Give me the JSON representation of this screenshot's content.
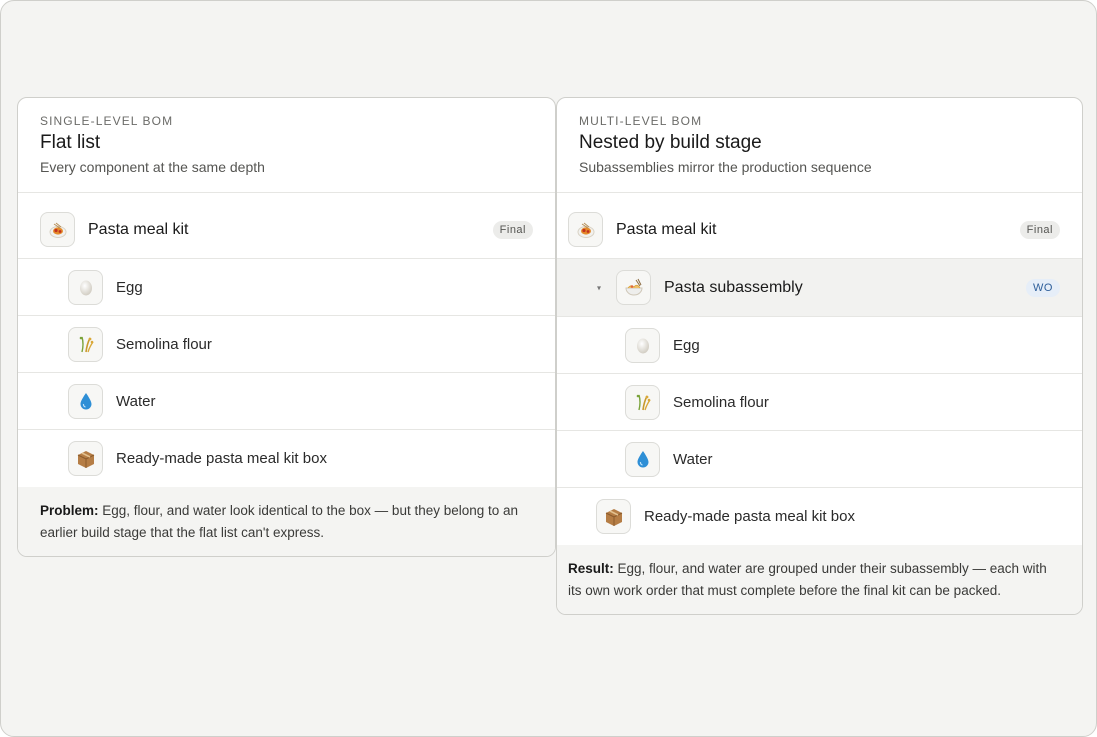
{
  "left": {
    "eyebrow": "SINGLE-LEVEL BOM",
    "title": "Flat list",
    "subtitle": "Every component at the same depth",
    "top_item": {
      "label": "Pasta meal kit",
      "badge": "Final",
      "icon": "pasta-plate-icon"
    },
    "items": [
      {
        "label": "Egg",
        "icon": "egg-icon"
      },
      {
        "label": "Semolina flour",
        "icon": "wheat-icon"
      },
      {
        "label": "Water",
        "icon": "water-drop-icon"
      },
      {
        "label": "Ready-made pasta meal kit box",
        "icon": "box-icon"
      }
    ],
    "note_lead": "Problem:",
    "note_text": " Egg, flour, and water look identical to the box — but they belong to an earlier build stage that the flat list can't express."
  },
  "right": {
    "eyebrow": "MULTI-LEVEL BOM",
    "title": "Nested by build stage",
    "subtitle": "Subassemblies mirror the production sequence",
    "top_item": {
      "label": "Pasta meal kit",
      "badge": "Final",
      "icon": "pasta-plate-icon"
    },
    "subassembly": {
      "label": "Pasta subassembly",
      "badge": "WO",
      "icon": "noodle-bowl-icon",
      "caret": "▾"
    },
    "sub_items": [
      {
        "label": "Egg",
        "icon": "egg-icon"
      },
      {
        "label": "Semolina flour",
        "icon": "wheat-icon"
      },
      {
        "label": "Water",
        "icon": "water-drop-icon"
      }
    ],
    "box_item": {
      "label": "Ready-made pasta meal kit box",
      "icon": "box-icon"
    },
    "note_lead": "Result:",
    "note_text": " Egg, flour, and water are grouped under their subassembly — each with its own work order that must complete before the final kit can be packed."
  },
  "colors": {
    "background": "#f4f4f2",
    "card": "#ffffff",
    "border": "#cfcfcb",
    "wo_badge": "#2f5f9a"
  }
}
